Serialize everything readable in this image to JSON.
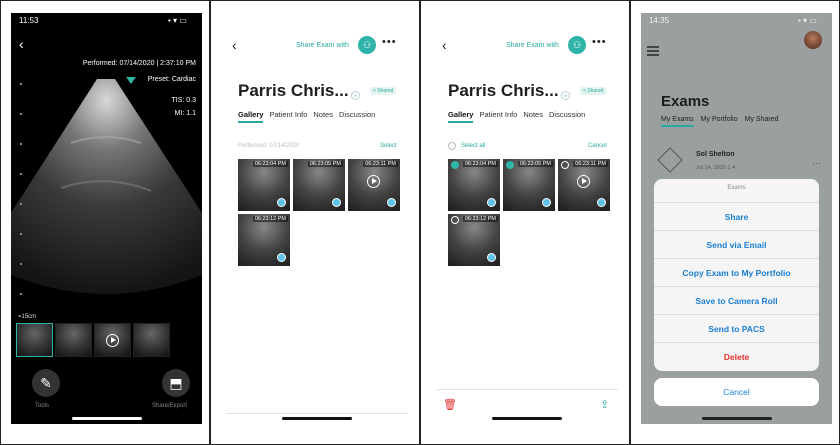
{
  "panel1": {
    "status_time": "11:53",
    "performed": "Performed: 07/14/2020 | 2:37:10 PM",
    "preset": "Preset: Cardiac",
    "tis": "TIS: 0.3",
    "mi": "MI: 1.1",
    "scale": "=15cm",
    "tools_label": "Tools",
    "share_export_label": "Share/Export",
    "icons": [
      "back-arrow-icon",
      "pencil-icon",
      "export-icon",
      "play-icon"
    ]
  },
  "panel2": {
    "share_label": "Share Exam with",
    "patient_name": "Parris Chris...",
    "shared_badge": "< Shared",
    "tabs": [
      "Gallery",
      "Patient Info",
      "Notes",
      "Discussion"
    ],
    "performed": "Performed: 07/14/2020",
    "select_label": "Select",
    "thumb_times": [
      "06:23:04 PM",
      "06:23:05 PM",
      "06:23:11 PM",
      "06:23:12 PM"
    ]
  },
  "panel3": {
    "share_label": "Share Exam with",
    "patient_name": "Parris Chris...",
    "shared_badge": "< Shared",
    "tabs": [
      "Gallery",
      "Patient Info",
      "Notes",
      "Discussion"
    ],
    "select_all": "Select all",
    "cancel": "Cancel",
    "thumb_times": [
      "06:23:04 PM",
      "06:23:05 PM",
      "06:23:11 PM",
      "06:23:12 PM"
    ],
    "icons": [
      "trash-icon",
      "share-upload-icon"
    ]
  },
  "panel4": {
    "status_time": "14:35",
    "title": "Exams",
    "tabs": [
      "My Exams",
      "My Portfolio",
      "My Shared"
    ],
    "exam_name": "Sol Shelton",
    "exam_meta": "Jul 14, 2020   1   4",
    "sheet_title": "Exams",
    "options": [
      "Share",
      "Send via Email",
      "Copy Exam to My Portfolio",
      "Save to Camera Roll",
      "Send to PACS",
      "Delete"
    ],
    "cancel": "Cancel"
  },
  "colors": {
    "accent": "#2aa9a0",
    "link_blue": "#1a7fd4",
    "danger": "#e0332f",
    "overlay": "#9aa09f"
  }
}
